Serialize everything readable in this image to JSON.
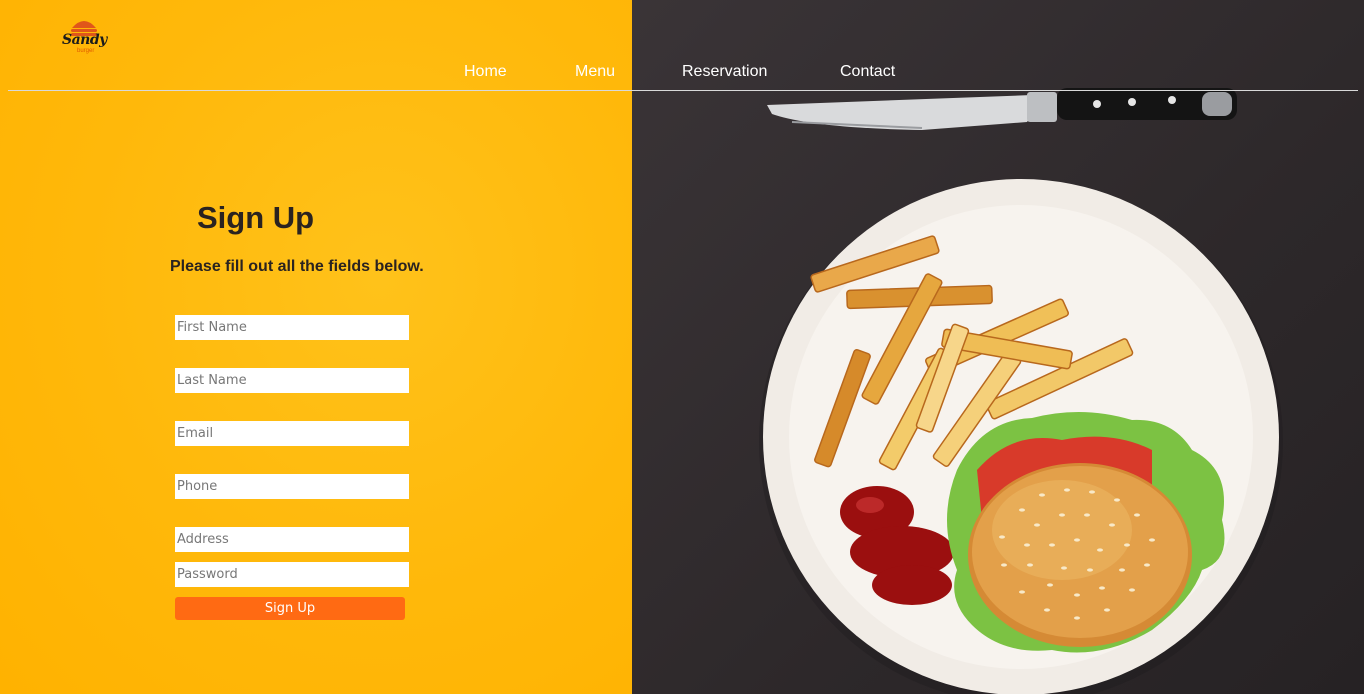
{
  "brand": {
    "name": "Sandy",
    "tagline": "burger",
    "logo_icon": "burger-icon",
    "accent": "#ff6a13"
  },
  "nav": {
    "items": [
      {
        "label": "Home"
      },
      {
        "label": "Menu"
      },
      {
        "label": "Reservation"
      },
      {
        "label": "Contact"
      }
    ]
  },
  "form": {
    "title": "Sign Up",
    "subtitle": "Please fill out all the fields below.",
    "fields": [
      {
        "placeholder": "First Name",
        "value": ""
      },
      {
        "placeholder": "Last Name",
        "value": ""
      },
      {
        "placeholder": "Email",
        "value": ""
      },
      {
        "placeholder": "Phone",
        "value": ""
      },
      {
        "placeholder": "Address",
        "value": ""
      },
      {
        "placeholder": "Password",
        "value": ""
      }
    ],
    "submit_label": "Sign Up"
  },
  "colors": {
    "left_bg": "#ffb800",
    "right_bg": "#2f2a2c",
    "button": "#ff6a13"
  }
}
